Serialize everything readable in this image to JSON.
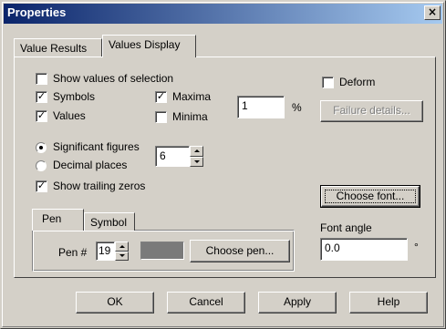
{
  "window": {
    "title": "Properties",
    "close_glyph": "×"
  },
  "tabs": [
    {
      "label": "Value Results",
      "active": false
    },
    {
      "label": "Values Display",
      "active": true
    }
  ],
  "options": {
    "show_values_selection": {
      "label": "Show values of selection",
      "checked": false
    },
    "symbols": {
      "label": "Symbols",
      "checked": true
    },
    "values": {
      "label": "Values",
      "checked": true
    },
    "maxima": {
      "label": "Maxima",
      "checked": true
    },
    "minima": {
      "label": "Minima",
      "checked": false
    },
    "percent": {
      "value": "1",
      "unit": "%"
    },
    "deform": {
      "label": "Deform",
      "checked": false
    },
    "failure_details": {
      "label": "Failure details..."
    },
    "significant_figures": {
      "label": "Significant figures",
      "selected": true
    },
    "decimal_places": {
      "label": "Decimal places",
      "selected": false
    },
    "digits": {
      "value": "6"
    },
    "show_trailing_zeros": {
      "label": "Show trailing zeros",
      "checked": true
    },
    "choose_font": {
      "label": "Choose font..."
    },
    "font_angle": {
      "label": "Font angle",
      "value": "0.0",
      "unit": "°"
    }
  },
  "pen_group": {
    "tabs": [
      {
        "label": "Pen",
        "active": true
      },
      {
        "label": "Symbol",
        "active": false
      }
    ],
    "pen_label": "Pen #",
    "pen_number": "19",
    "pen_color": "#7a7a7a",
    "choose_pen": "Choose pen..."
  },
  "buttons": {
    "ok": "OK",
    "cancel": "Cancel",
    "apply": "Apply",
    "help": "Help"
  },
  "colors": {
    "face": "#d4d0c8",
    "title_start": "#0a246a",
    "title_end": "#a6caf0"
  }
}
